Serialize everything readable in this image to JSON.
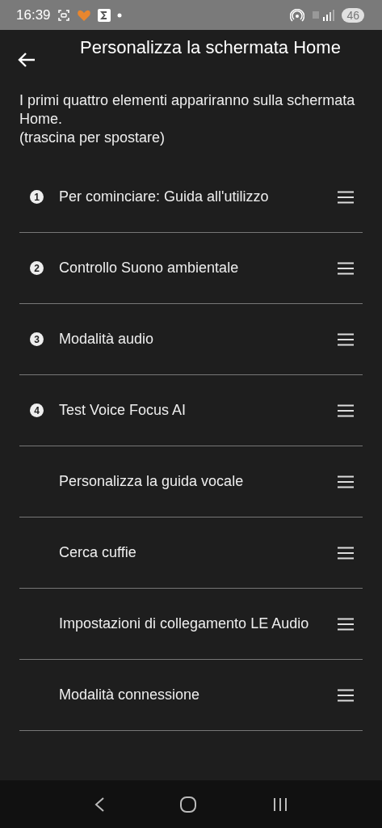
{
  "status_bar": {
    "time": "16:39",
    "battery": "46"
  },
  "header": {
    "title": "Personalizza la schermata Home"
  },
  "description": [
    "I primi quattro elementi appariranno sulla schermata Home.",
    "(trascina per spostare)"
  ],
  "items": [
    {
      "badge": "1",
      "label": "Per cominciare: Guida all'utilizzo"
    },
    {
      "badge": "2",
      "label": "Controllo Suono ambientale"
    },
    {
      "badge": "3",
      "label": "Modalità audio"
    },
    {
      "badge": "4",
      "label": "Test Voice Focus AI"
    },
    {
      "label": "Personalizza la guida vocale"
    },
    {
      "label": "Cerca cuffie"
    },
    {
      "label": "Impostazioni di collegamento LE Audio"
    },
    {
      "label": "Modalità connessione"
    }
  ]
}
